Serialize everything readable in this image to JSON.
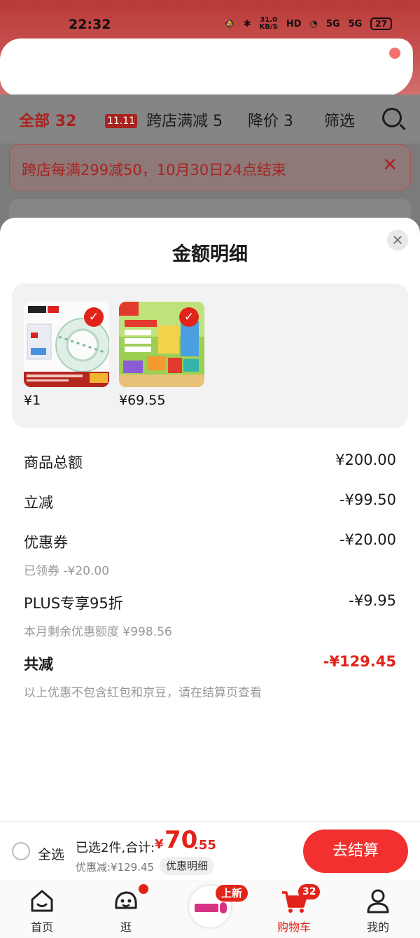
{
  "status_bar": {
    "time": "22:32",
    "speed": "31.0\nKB/S",
    "signal_1": "5G",
    "signal_2": "5G",
    "battery": "27"
  },
  "tabs": [
    {
      "label": "全部",
      "count": "32"
    },
    {
      "label": "跨店满减",
      "count": "5",
      "icon_text": "11.11"
    },
    {
      "label": "降价",
      "count": "3"
    },
    {
      "label": "筛选"
    }
  ],
  "promo_banner": {
    "text": "跨店每满299减50，10月30日24点结束"
  },
  "sheet": {
    "title": "金额明细",
    "products": [
      {
        "price": "¥1",
        "image": "tape-product-image",
        "checked": true
      },
      {
        "price": "¥69.55",
        "image": "building-blocks-product-image",
        "checked": true
      }
    ],
    "rows": {
      "goods_total": {
        "label": "商品总额",
        "value": "¥200.00"
      },
      "instant_discount": {
        "label": "立减",
        "value": "-¥99.50"
      },
      "coupon": {
        "label": "优惠券",
        "value": "-¥20.00",
        "sub": "已领券 -¥20.00"
      },
      "plus": {
        "label": "PLUS专享95折",
        "value": "-¥9.95",
        "sub": "本月剩余优惠额度 ¥998.56"
      },
      "total_discount": {
        "label": "共减",
        "value": "-¥129.45",
        "sub": "以上优惠不包含红包和京豆，请在结算页查看"
      }
    }
  },
  "checkout": {
    "select_all": "全选",
    "selected": "已选2件,合计:",
    "currency": "¥",
    "total_int": "70",
    "total_dec": ".55",
    "discount": "优惠减:¥129.45",
    "detail_chip": "优惠明细",
    "button": "去结算"
  },
  "nav": {
    "home": "首页",
    "explore": "逛",
    "new_badge": "上新",
    "cart": "购物车",
    "cart_count": "32",
    "mine": "我的"
  },
  "colors": {
    "accent": "#e2231a",
    "button": "#f23030",
    "status_bg": "#c04645"
  }
}
